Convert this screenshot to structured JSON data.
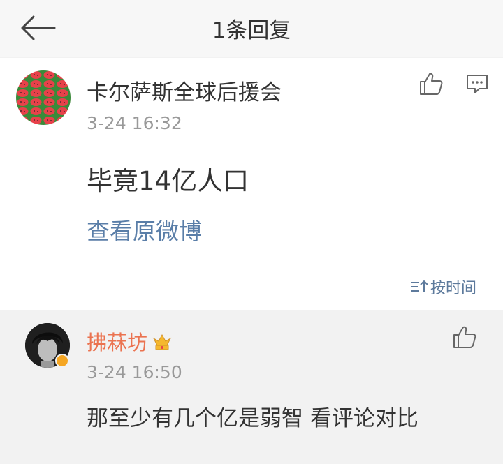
{
  "header": {
    "title": "1条回复",
    "back_icon": "arrow-left-icon"
  },
  "main_comment": {
    "username": "卡尔萨斯全球后援会",
    "timestamp": "3-24 16:32",
    "text": "毕竟14亿人口",
    "view_original_label": "查看原微博",
    "like_icon": "thumbs-up-icon",
    "comment_icon": "comment-icon"
  },
  "sort": {
    "label": "按时间",
    "icon": "sort-icon"
  },
  "reply": {
    "username": "拂菻坊",
    "timestamp": "3-24 16:50",
    "text": "那至少有几个亿是弱智 看评论对比",
    "badge_icon": "crown-icon",
    "like_icon": "thumbs-up-icon"
  },
  "colors": {
    "link": "#5a7ea8",
    "reply_name": "#eb7350",
    "timestamp": "#999999",
    "verified_badge": "#f5a623"
  }
}
